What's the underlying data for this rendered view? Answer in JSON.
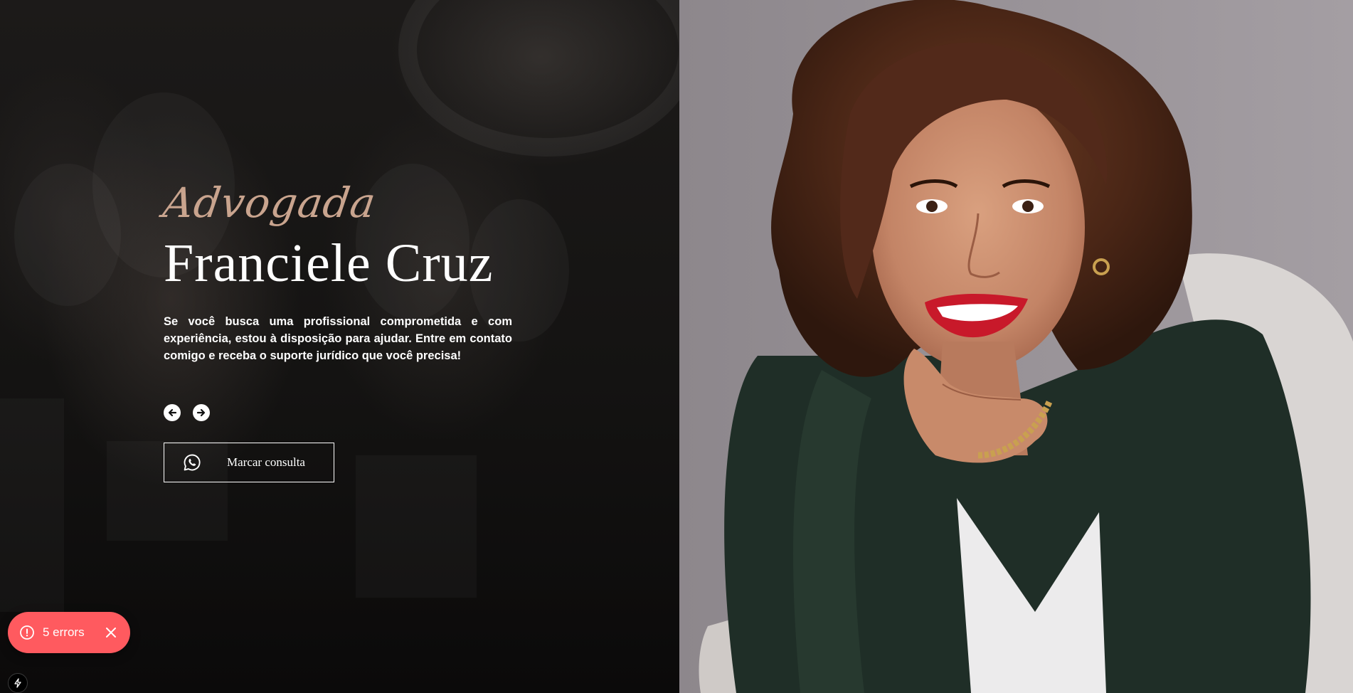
{
  "hero": {
    "subtitle": "Advogada",
    "title": "Franciele Cruz",
    "description": "Se você busca uma profissional comprometida e com experiência, estou à disposição para ajudar. Entre em contato comigo e receba o suporte jurídico que você precisa!",
    "prev_icon": "arrow-left-icon",
    "next_icon": "arrow-right-icon",
    "cta": {
      "label": "Marcar consulta",
      "icon": "whatsapp-icon"
    }
  },
  "error_toast": {
    "label": "5 errors",
    "icon": "alert-circle-icon",
    "close_icon": "close-icon"
  },
  "dev_badge": {
    "icon": "lightning-bolt-icon"
  },
  "colors": {
    "accent": "#c9a48e",
    "error": "#ff5a5f",
    "text": "#ffffff",
    "background": "#141312"
  }
}
